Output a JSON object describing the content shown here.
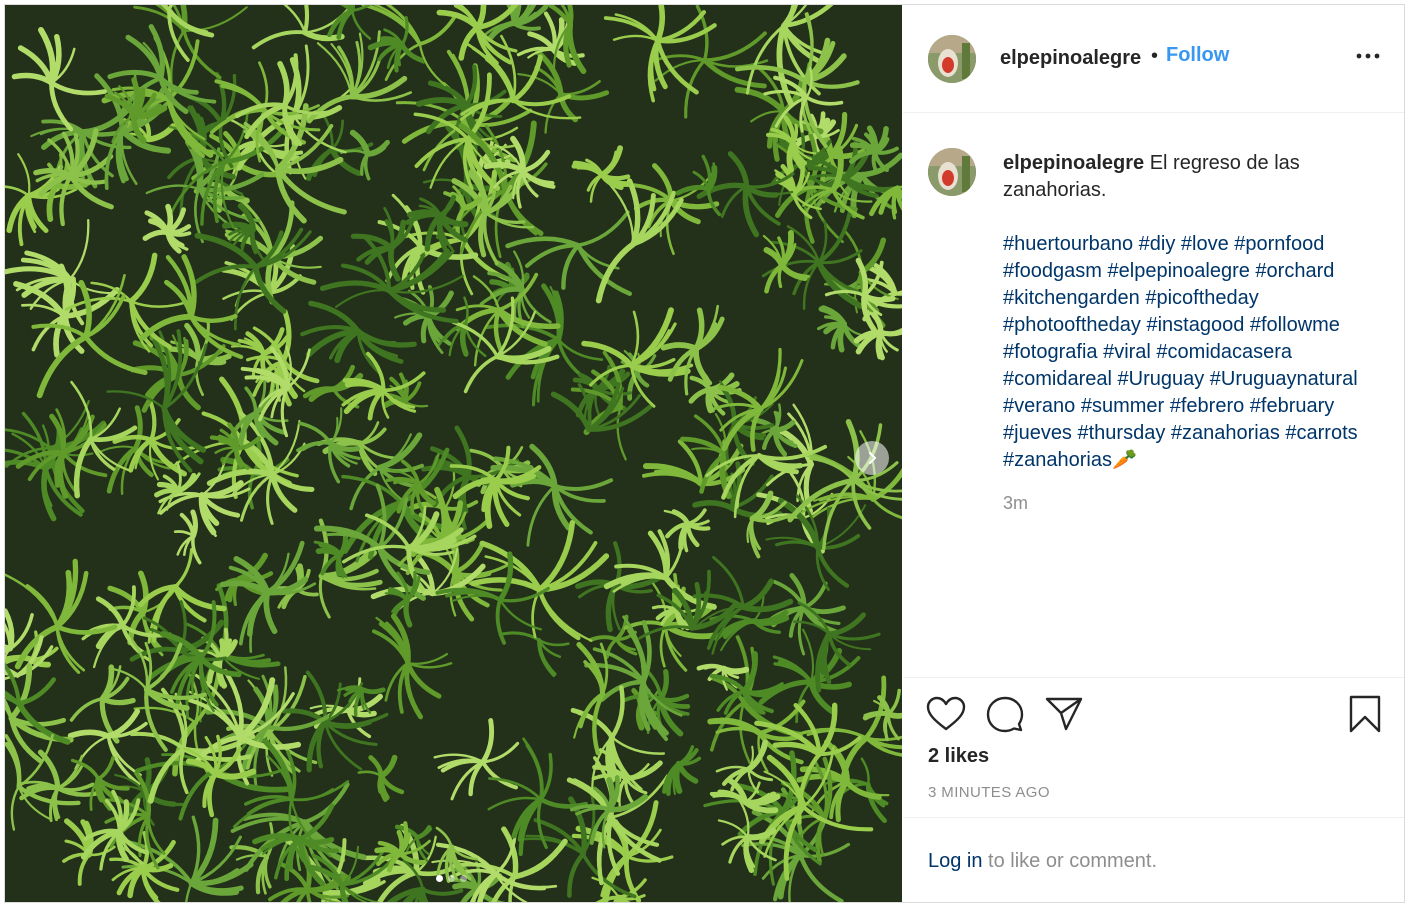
{
  "post": {
    "username": "elpepinoalegre",
    "separator": "•",
    "follow_label": "Follow",
    "more_icon": "more-horizontal-icon"
  },
  "caption": {
    "username": "elpepinoalegre",
    "text": "El regreso de las zanahorias.",
    "hashtag_lines": [
      "#huertourbano #diy #love #pornfood",
      "#foodgasm #elpepinoalegre #orchard",
      "#kitchengarden #picoftheday",
      "#photooftheday #instagood #followme",
      "#fotografia #viral #comidacasera",
      "#comidareal #Uruguay #Uruguaynatural",
      "#verano #summer #febrero #february",
      "#jueves #thursday #zanahorias #carrots",
      "#zanahorias🥕"
    ],
    "time": "3m"
  },
  "engagement": {
    "likes": "2 likes",
    "timestamp": "3 MINUTES AGO"
  },
  "footer": {
    "login_link": "Log in",
    "login_rest": " to like or comment."
  },
  "icons": {
    "like": "heart-icon",
    "comment": "comment-icon",
    "share": "paper-plane-icon",
    "save": "bookmark-icon",
    "next": "chevron-right-icon"
  },
  "colors": {
    "link_blue": "#3897f0",
    "hashtag": "#003569",
    "text": "#262626",
    "muted": "#8e8e8e"
  },
  "carousel": {
    "slide_count": 3,
    "active_index": 0
  }
}
